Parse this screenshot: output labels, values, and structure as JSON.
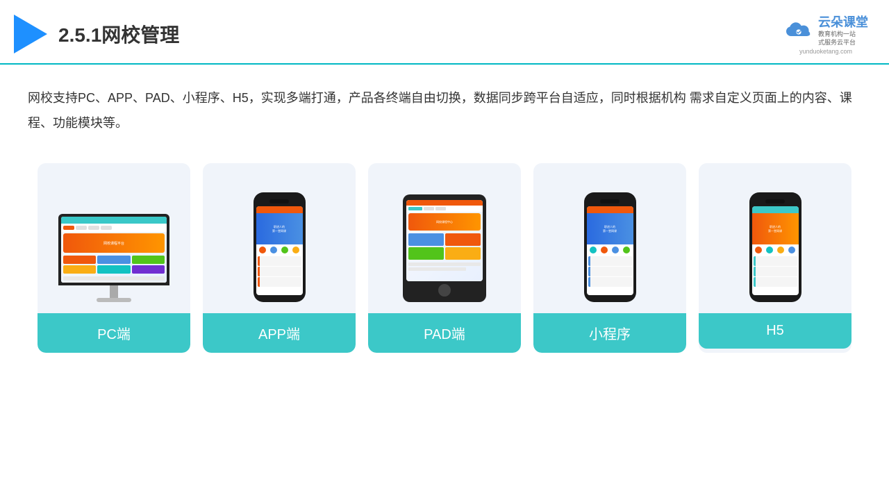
{
  "header": {
    "title": "2.5.1网校管理",
    "brand_name": "云朵课堂",
    "brand_tagline": "教育机构一站\n式服务云平台",
    "brand_url": "yunduoketang.com"
  },
  "description": "网校支持PC、APP、PAD、小程序、H5，实现多端打通，产品各终端自由切换，数据同步跨平台自适应，同时根据机构\n需求自定义页面上的内容、课程、功能模块等。",
  "cards": [
    {
      "id": "pc",
      "label": "PC端",
      "device": "pc"
    },
    {
      "id": "app",
      "label": "APP端",
      "device": "phone"
    },
    {
      "id": "pad",
      "label": "PAD端",
      "device": "tablet"
    },
    {
      "id": "miniprogram",
      "label": "小程序",
      "device": "phone"
    },
    {
      "id": "h5",
      "label": "H5",
      "device": "phone"
    }
  ],
  "accent_color": "#3cc8c8",
  "title_color": "#333333"
}
